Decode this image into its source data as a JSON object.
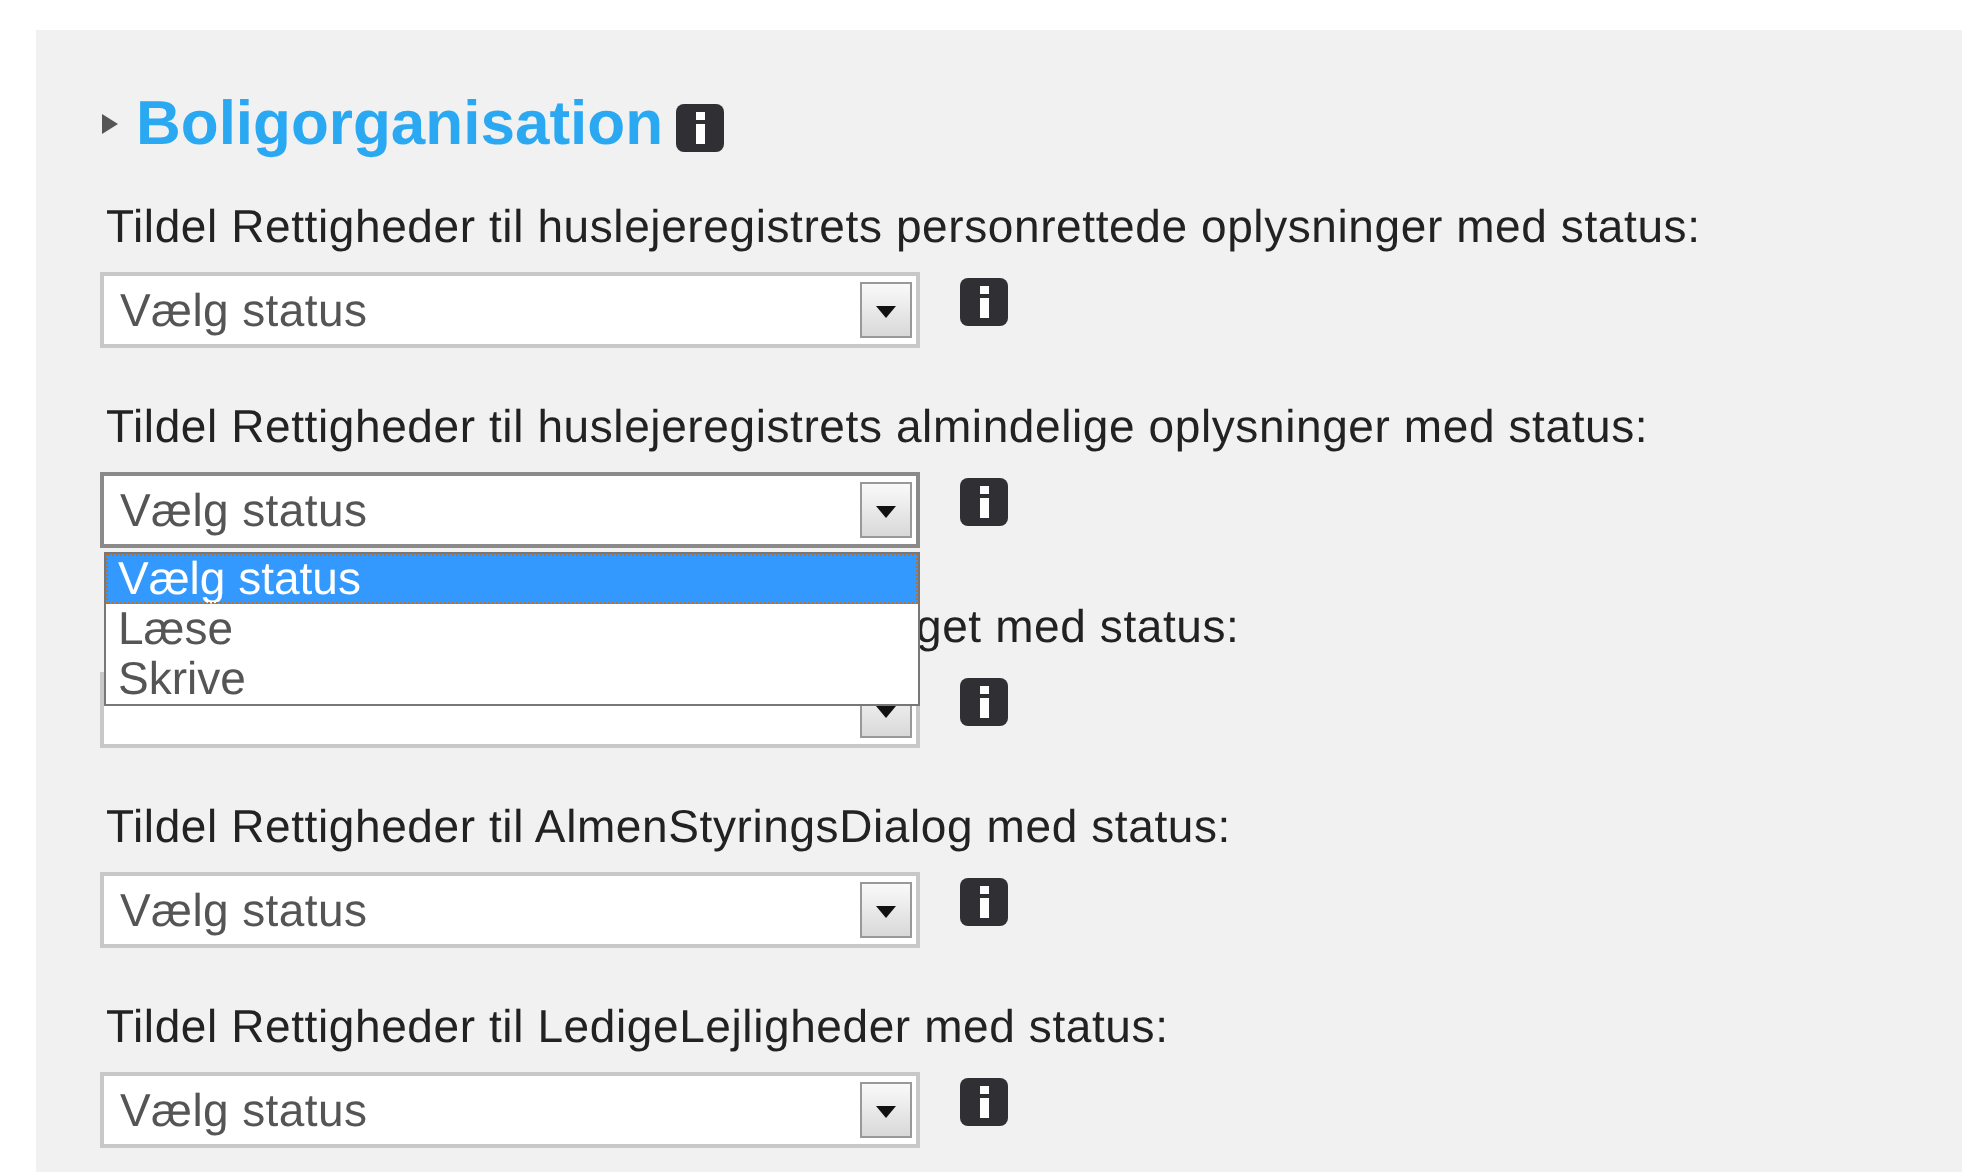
{
  "section": {
    "title": "Boligorganisation",
    "expanded": false
  },
  "rows": [
    {
      "label": "Tildel Rettigheder til huslejeregistrets personrettede oplysninger med status:",
      "value": "Vælg status",
      "covered": false
    },
    {
      "label": "Tildel Rettigheder til huslejeregistrets almindelige oplysninger med status:",
      "value": "Vælg status",
      "covered": false,
      "open": true,
      "options": [
        {
          "label": "Vælg status",
          "selected": true
        },
        {
          "label": "Læse",
          "selected": false
        },
        {
          "label": "Skrive",
          "selected": false
        }
      ]
    },
    {
      "label": "get med status:",
      "covered": true
    },
    {
      "label": "Tildel Rettigheder til AlmenStyringsDialog med status:",
      "value": "Vælg status",
      "covered": false
    },
    {
      "label": "Tildel Rettigheder til LedigeLejligheder med status:",
      "value": "Vælg status",
      "covered": false
    }
  ]
}
